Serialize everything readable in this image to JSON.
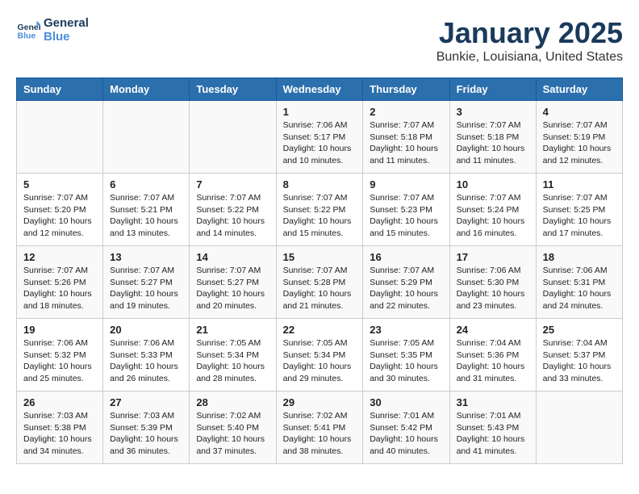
{
  "header": {
    "logo_line1": "General",
    "logo_line2": "Blue",
    "title": "January 2025",
    "subtitle": "Bunkie, Louisiana, United States"
  },
  "days_of_week": [
    "Sunday",
    "Monday",
    "Tuesday",
    "Wednesday",
    "Thursday",
    "Friday",
    "Saturday"
  ],
  "weeks": [
    [
      {
        "day": "",
        "info": ""
      },
      {
        "day": "",
        "info": ""
      },
      {
        "day": "",
        "info": ""
      },
      {
        "day": "1",
        "info": "Sunrise: 7:06 AM\nSunset: 5:17 PM\nDaylight: 10 hours\nand 10 minutes."
      },
      {
        "day": "2",
        "info": "Sunrise: 7:07 AM\nSunset: 5:18 PM\nDaylight: 10 hours\nand 11 minutes."
      },
      {
        "day": "3",
        "info": "Sunrise: 7:07 AM\nSunset: 5:18 PM\nDaylight: 10 hours\nand 11 minutes."
      },
      {
        "day": "4",
        "info": "Sunrise: 7:07 AM\nSunset: 5:19 PM\nDaylight: 10 hours\nand 12 minutes."
      }
    ],
    [
      {
        "day": "5",
        "info": "Sunrise: 7:07 AM\nSunset: 5:20 PM\nDaylight: 10 hours\nand 12 minutes."
      },
      {
        "day": "6",
        "info": "Sunrise: 7:07 AM\nSunset: 5:21 PM\nDaylight: 10 hours\nand 13 minutes."
      },
      {
        "day": "7",
        "info": "Sunrise: 7:07 AM\nSunset: 5:22 PM\nDaylight: 10 hours\nand 14 minutes."
      },
      {
        "day": "8",
        "info": "Sunrise: 7:07 AM\nSunset: 5:22 PM\nDaylight: 10 hours\nand 15 minutes."
      },
      {
        "day": "9",
        "info": "Sunrise: 7:07 AM\nSunset: 5:23 PM\nDaylight: 10 hours\nand 15 minutes."
      },
      {
        "day": "10",
        "info": "Sunrise: 7:07 AM\nSunset: 5:24 PM\nDaylight: 10 hours\nand 16 minutes."
      },
      {
        "day": "11",
        "info": "Sunrise: 7:07 AM\nSunset: 5:25 PM\nDaylight: 10 hours\nand 17 minutes."
      }
    ],
    [
      {
        "day": "12",
        "info": "Sunrise: 7:07 AM\nSunset: 5:26 PM\nDaylight: 10 hours\nand 18 minutes."
      },
      {
        "day": "13",
        "info": "Sunrise: 7:07 AM\nSunset: 5:27 PM\nDaylight: 10 hours\nand 19 minutes."
      },
      {
        "day": "14",
        "info": "Sunrise: 7:07 AM\nSunset: 5:27 PM\nDaylight: 10 hours\nand 20 minutes."
      },
      {
        "day": "15",
        "info": "Sunrise: 7:07 AM\nSunset: 5:28 PM\nDaylight: 10 hours\nand 21 minutes."
      },
      {
        "day": "16",
        "info": "Sunrise: 7:07 AM\nSunset: 5:29 PM\nDaylight: 10 hours\nand 22 minutes."
      },
      {
        "day": "17",
        "info": "Sunrise: 7:06 AM\nSunset: 5:30 PM\nDaylight: 10 hours\nand 23 minutes."
      },
      {
        "day": "18",
        "info": "Sunrise: 7:06 AM\nSunset: 5:31 PM\nDaylight: 10 hours\nand 24 minutes."
      }
    ],
    [
      {
        "day": "19",
        "info": "Sunrise: 7:06 AM\nSunset: 5:32 PM\nDaylight: 10 hours\nand 25 minutes."
      },
      {
        "day": "20",
        "info": "Sunrise: 7:06 AM\nSunset: 5:33 PM\nDaylight: 10 hours\nand 26 minutes."
      },
      {
        "day": "21",
        "info": "Sunrise: 7:05 AM\nSunset: 5:34 PM\nDaylight: 10 hours\nand 28 minutes."
      },
      {
        "day": "22",
        "info": "Sunrise: 7:05 AM\nSunset: 5:34 PM\nDaylight: 10 hours\nand 29 minutes."
      },
      {
        "day": "23",
        "info": "Sunrise: 7:05 AM\nSunset: 5:35 PM\nDaylight: 10 hours\nand 30 minutes."
      },
      {
        "day": "24",
        "info": "Sunrise: 7:04 AM\nSunset: 5:36 PM\nDaylight: 10 hours\nand 31 minutes."
      },
      {
        "day": "25",
        "info": "Sunrise: 7:04 AM\nSunset: 5:37 PM\nDaylight: 10 hours\nand 33 minutes."
      }
    ],
    [
      {
        "day": "26",
        "info": "Sunrise: 7:03 AM\nSunset: 5:38 PM\nDaylight: 10 hours\nand 34 minutes."
      },
      {
        "day": "27",
        "info": "Sunrise: 7:03 AM\nSunset: 5:39 PM\nDaylight: 10 hours\nand 36 minutes."
      },
      {
        "day": "28",
        "info": "Sunrise: 7:02 AM\nSunset: 5:40 PM\nDaylight: 10 hours\nand 37 minutes."
      },
      {
        "day": "29",
        "info": "Sunrise: 7:02 AM\nSunset: 5:41 PM\nDaylight: 10 hours\nand 38 minutes."
      },
      {
        "day": "30",
        "info": "Sunrise: 7:01 AM\nSunset: 5:42 PM\nDaylight: 10 hours\nand 40 minutes."
      },
      {
        "day": "31",
        "info": "Sunrise: 7:01 AM\nSunset: 5:43 PM\nDaylight: 10 hours\nand 41 minutes."
      },
      {
        "day": "",
        "info": ""
      }
    ]
  ]
}
